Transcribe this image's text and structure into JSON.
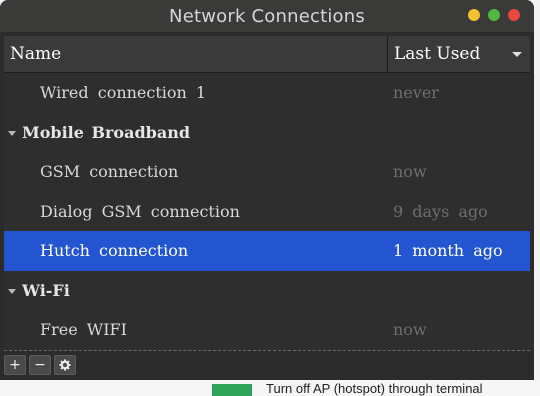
{
  "window": {
    "title": "Network Connections",
    "controls": [
      {
        "name": "minimize",
        "color": "#f2c230"
      },
      {
        "name": "maximize",
        "color": "#52b742"
      },
      {
        "name": "close",
        "color": "#e8463e"
      }
    ]
  },
  "table": {
    "columns": {
      "name": "Name",
      "last_used": "Last Used"
    },
    "rows": [
      {
        "kind": "item",
        "name": "Wired connection 1",
        "last_used": "never"
      },
      {
        "kind": "group",
        "name": "Mobile Broadband"
      },
      {
        "kind": "item",
        "name": "GSM connection",
        "last_used": "now"
      },
      {
        "kind": "item",
        "name": "Dialog GSM connection",
        "last_used": "9 days ago"
      },
      {
        "kind": "item",
        "name": "Hutch connection",
        "last_used": "1 month ago",
        "selected": true
      },
      {
        "kind": "group",
        "name": "Wi-Fi"
      },
      {
        "kind": "item",
        "name": "Free WIFI",
        "last_used": "now"
      }
    ]
  },
  "toolbar": {
    "add": "+",
    "remove": "−",
    "settings_icon": "gear-icon"
  },
  "background": {
    "snippet": "Turn off AP (hotspot) through terminal"
  },
  "colors": {
    "selection": "#2355d1",
    "window_bg": "#2b2b2b"
  }
}
